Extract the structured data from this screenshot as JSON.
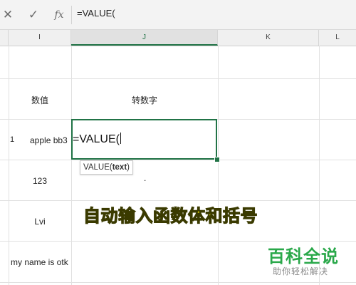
{
  "formula_bar": {
    "cancel_icon": "close-icon",
    "cancel_glyph": "✕",
    "enter_icon": "check-icon",
    "enter_glyph": "✓",
    "fx_label": "fx",
    "formula": "=VALUE("
  },
  "columns": [
    {
      "label": "I",
      "active": false
    },
    {
      "label": "J",
      "active": true
    },
    {
      "label": "K",
      "active": false
    },
    {
      "label": "L",
      "active": false
    }
  ],
  "cells": {
    "i_header": "数值",
    "j_header": "转数字",
    "row_number": "1",
    "i_row1": "apple bb3",
    "j_row1": "=VALUE(",
    "i_row2": "123",
    "j_row2": ".",
    "i_row3": "Lvi",
    "i_row4": "my name is otk"
  },
  "tooltip": {
    "function_name": "VALUE(",
    "argument": "text",
    "close": ")"
  },
  "annotation": "自动输入函数体和括号",
  "watermark": {
    "main": "百科全说",
    "sub": "助你轻松解决"
  },
  "colors": {
    "accent": "#217346",
    "annotation_fill": "#f4e500",
    "watermark": "#2aa84a"
  }
}
